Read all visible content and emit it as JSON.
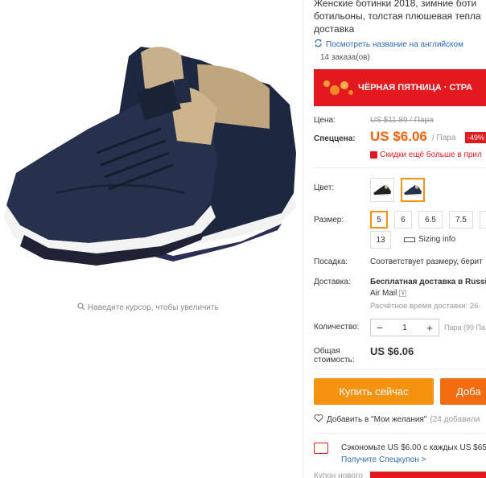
{
  "gallery": {
    "zoom_hint": "Наведите курсор, чтобы увеличить"
  },
  "product": {
    "title_lines": [
      "Женские ботинки 2018, зимние боти",
      "ботильоны, толстая плюшевая тепла",
      "доставка"
    ],
    "translate_link": "Посмотреть название на английском",
    "orders": "14 заказа(ов)"
  },
  "banner": {
    "text": "ЧЁРНАЯ ПЯТНИЦА · СТРА"
  },
  "price": {
    "label_price": "Цена:",
    "old_price": "US $11.89 / Пара",
    "label_special": "Спеццена:",
    "current_price": "US $6.06",
    "per_unit": "/ Пара",
    "discount": "-49%",
    "coupon_hint": "Скидки ещё больше в прил"
  },
  "options": {
    "color_label": "Цвет:",
    "colors": [
      "black",
      "navy"
    ],
    "selected_color_index": 1,
    "size_label": "Размер:",
    "sizes": [
      "5",
      "6",
      "6.5",
      "7.5",
      "",
      "13"
    ],
    "selected_size": "5",
    "size_info": "Sizing info"
  },
  "fit": {
    "label": "Посадка:",
    "value": "Соответствует размеру, берит"
  },
  "delivery": {
    "label": "Доставка:",
    "value": "Бесплатная доставка в Russi",
    "method": "Air Mail",
    "estimate": "Расчётное время доставки: 26"
  },
  "quantity": {
    "label": "Количество:",
    "value": "1",
    "minus": "−",
    "plus": "+",
    "note": "Пара (99 Па"
  },
  "total": {
    "label": "Общая стоимость:",
    "value": "US $6.06"
  },
  "actions": {
    "buy_now": "Купить сейчас",
    "add_to_cart": "Доба"
  },
  "wishlist": {
    "text": "Добавить в \"Мои желания\"",
    "count": "(24 добавили"
  },
  "coupon": {
    "save_text": "Сэкономьте US $6.00 с каждых US $65",
    "link": "Получите Спецкупон >",
    "new_coupon_label": "Купон нового"
  },
  "colors": {
    "accent_orange": "#f5920f",
    "price_orange": "#f5620f",
    "sale_red": "#e4191f",
    "link_blue": "#2f6ab5"
  }
}
